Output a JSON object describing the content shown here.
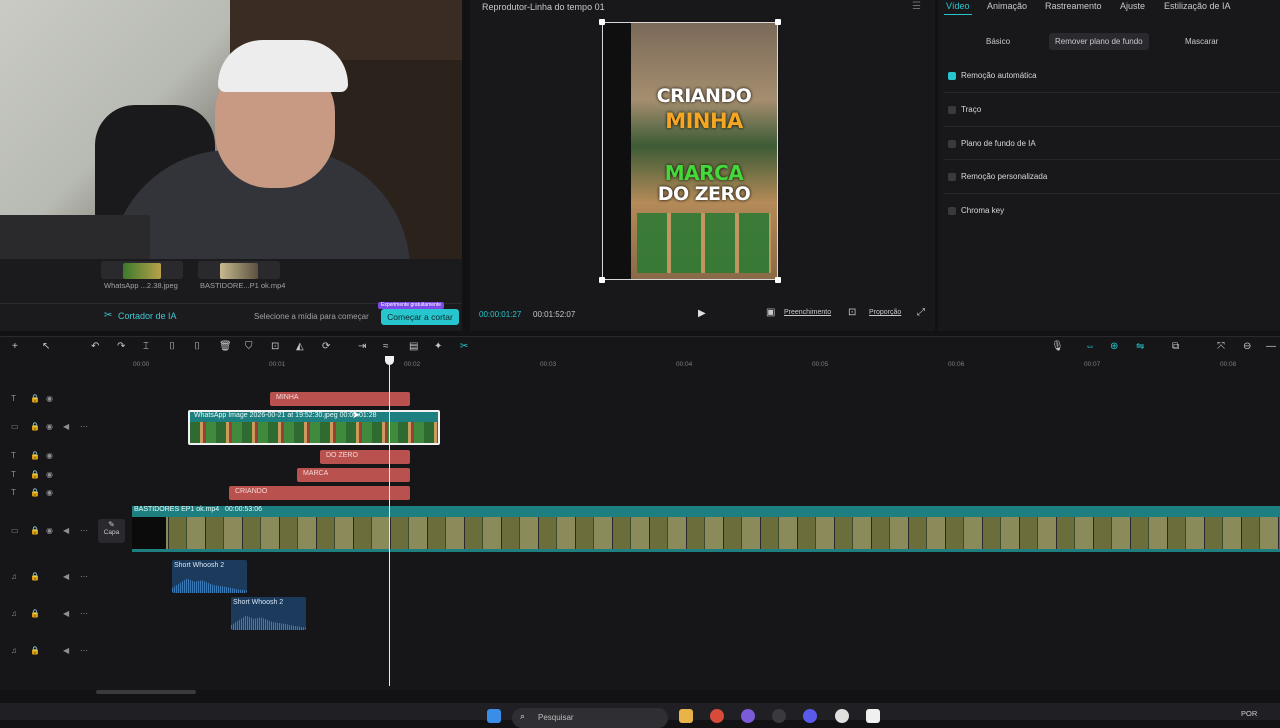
{
  "media": {
    "items": [
      {
        "label": "WhatsApp ...2.38.jpeg"
      },
      {
        "label": "BASTIDORE...P1 ok.mp4"
      }
    ],
    "cutter_title": "Cortador de IA",
    "cutter_hint": "Selecione a mídia para começar",
    "start_button": "Começar a cortar",
    "promo_badge": "Experimente gratuitamente"
  },
  "player": {
    "title": "Reprodutor-Linha do tempo 01",
    "current_time": "00:00:01:27",
    "total_time": "00:01:52:07",
    "fill_label": "Preenchimento",
    "ratio_label": "Proporção",
    "preview_lines": [
      "CRIANDO",
      "MINHA",
      "MARCA",
      "DO ZERO"
    ]
  },
  "inspector": {
    "tabs": [
      "Vídeo",
      "Animação",
      "Rastreamento",
      "Ajuste",
      "Estilização de IA"
    ],
    "subtabs": [
      "Básico",
      "Remover plano de fundo",
      "Mascarar"
    ],
    "options": [
      {
        "label": "Remoção automática",
        "checked": true
      },
      {
        "label": "Traço",
        "checked": false
      },
      {
        "label": "Plano de fundo de IA",
        "checked": false
      },
      {
        "label": "Remoção personalizada",
        "checked": false
      },
      {
        "label": "Chroma key",
        "checked": false
      }
    ]
  },
  "ruler": {
    "ticks": [
      "00:00",
      "00:01",
      "00:02",
      "00:03",
      "00:04",
      "00:05",
      "00:06",
      "00:07",
      "00:08"
    ]
  },
  "timeline": {
    "text_clips": [
      "MINHA",
      "DO ZERO",
      "MARCA",
      "CRIANDO"
    ],
    "image_clip_label": "WhatsApp Image 2026-00-21 at 19:52:30.jpeg",
    "image_clip_duration": "00:00:01:28",
    "main_clip_label": "BASTIDORES EP1 ok.mp4",
    "main_clip_duration": "00:00:53:06",
    "cover_label": "Capa",
    "audio_clips": [
      "Short Whoosh 2",
      "Short Whoosh 2"
    ]
  },
  "taskbar": {
    "search_placeholder": "Pesquisar",
    "language": "POR"
  },
  "colors": {
    "accent": "#27c6cf",
    "text_clip": "#b9524e",
    "video_clip": "#1e7f80",
    "audio_clip": "#1b3a5c"
  }
}
